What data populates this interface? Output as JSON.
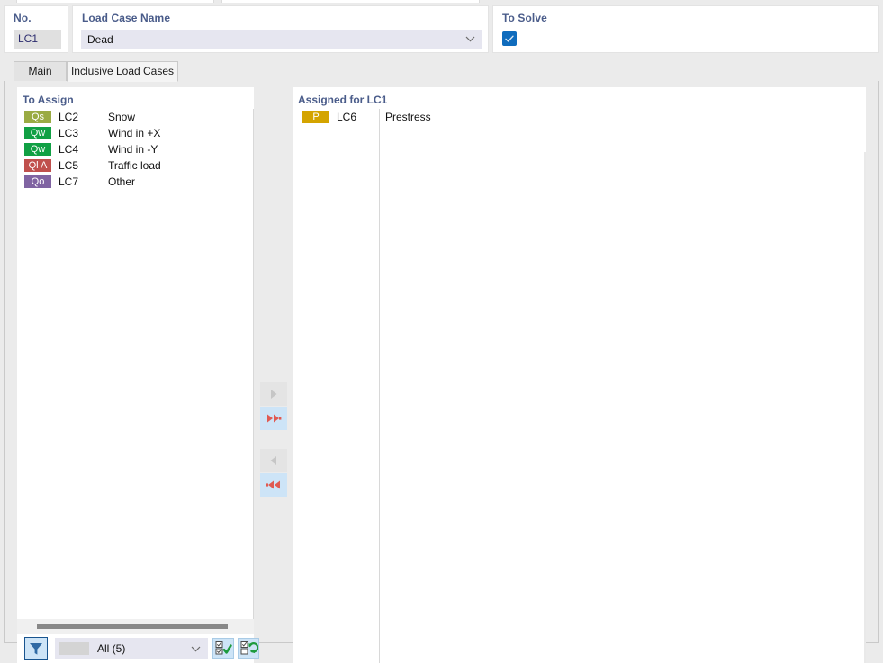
{
  "header": {
    "no": {
      "label": "No.",
      "value": "LC1"
    },
    "load_case_name": {
      "label": "Load Case Name",
      "value": "Dead",
      "chevron_icon": "chevron-down-icon"
    },
    "to_solve": {
      "label": "To Solve",
      "checked": true,
      "check_icon": "check-icon",
      "accent_color": "#0f6cbd"
    }
  },
  "tabs": [
    {
      "label": "Main",
      "active": false
    },
    {
      "label": "Inclusive Load Cases",
      "active": true
    }
  ],
  "to_assign": {
    "title": "To Assign",
    "rows": [
      {
        "badge": "Qs",
        "badge_color": "#9aab43",
        "no": "LC2",
        "name": "Snow"
      },
      {
        "badge": "Qw",
        "badge_color": "#11a044",
        "no": "LC3",
        "name": "Wind in +X"
      },
      {
        "badge": "Qw",
        "badge_color": "#11a044",
        "no": "LC4",
        "name": "Wind in -Y"
      },
      {
        "badge": "Ql A",
        "badge_color": "#c0504d",
        "no": "LC5",
        "name": "Traffic load"
      },
      {
        "badge": "Qo",
        "badge_color": "#8064a2",
        "no": "LC7",
        "name": "Other"
      }
    ]
  },
  "assigned": {
    "title": "Assigned for LC1",
    "rows": [
      {
        "badge": "P",
        "badge_color": "#d4a400",
        "no": "LC6",
        "name": "Prestress"
      }
    ]
  },
  "transfer_buttons": [
    {
      "name": "assign-single-button",
      "icon": "single-right-arrow-icon",
      "enabled": false,
      "direction": "right",
      "double": false
    },
    {
      "name": "assign-all-button",
      "icon": "double-right-arrow-icon",
      "enabled": true,
      "direction": "right",
      "double": true
    },
    {
      "name": "unassign-single-button",
      "icon": "single-left-arrow-icon",
      "enabled": false,
      "direction": "left",
      "double": false
    },
    {
      "name": "unassign-all-button",
      "icon": "double-left-arrow-icon",
      "enabled": true,
      "direction": "left",
      "double": true
    }
  ],
  "toolbar": {
    "filter_button": {
      "icon": "filter-funnel-icon",
      "active": true
    },
    "filter_select": {
      "value": "All (5)",
      "chevron_icon": "chevron-down-icon"
    },
    "select_all_button": {
      "icon": "select-all-checkmark-icon"
    },
    "invert_selection_button": {
      "icon": "invert-selection-icon"
    }
  },
  "colors": {
    "label_blue": "#4a5c8a",
    "accent_blue": "#0f6cbd",
    "arrow_red": "#e05a52",
    "button_highlight": "#cde4f7",
    "window_bg": "#ebebeb"
  }
}
